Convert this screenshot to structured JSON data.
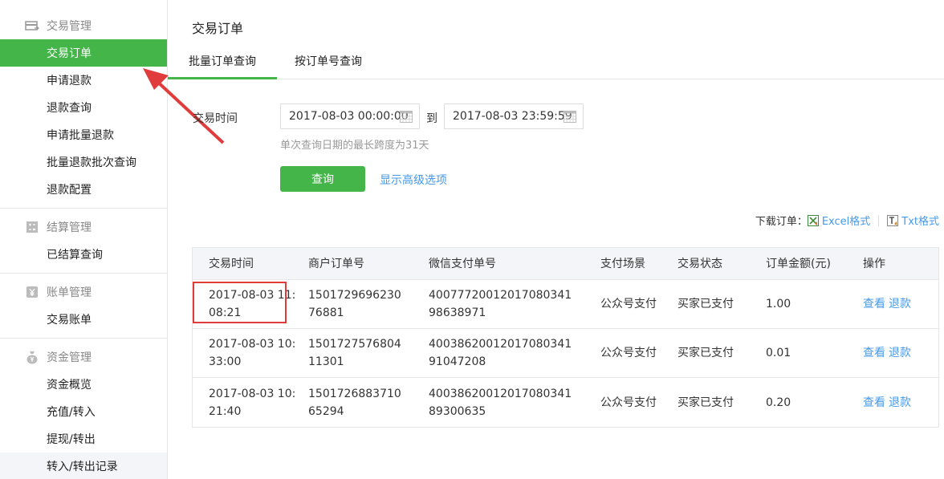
{
  "sidebar": {
    "sections": [
      {
        "title": "交易管理",
        "icon": "transaction-icon",
        "items": [
          "交易订单",
          "申请退款",
          "退款查询",
          "申请批量退款",
          "批量退款批次查询",
          "退款配置"
        ]
      },
      {
        "title": "结算管理",
        "icon": "calculator-icon",
        "items": [
          "已结算查询"
        ]
      },
      {
        "title": "账单管理",
        "icon": "yuan-icon",
        "items": [
          "交易账单"
        ]
      },
      {
        "title": "资金管理",
        "icon": "money-bag-icon",
        "items": [
          "资金概览",
          "充值/转入",
          "提现/转出",
          "转入/转出记录"
        ]
      }
    ]
  },
  "page": {
    "title": "交易订单"
  },
  "tabs": [
    "批量订单查询",
    "按订单号查询"
  ],
  "filter": {
    "time_label": "交易时间",
    "start": "2017-08-03 00:00:00",
    "to": "到",
    "end": "2017-08-03 23:59:59",
    "hint": "单次查询日期的最长跨度为31天",
    "query_btn": "查询",
    "advanced_link": "显示高级选项"
  },
  "download": {
    "label": "下载订单：",
    "excel": "Excel格式",
    "txt": "Txt格式"
  },
  "table": {
    "headers": [
      "交易时间",
      "商户订单号",
      "微信支付单号",
      "支付场景",
      "交易状态",
      "订单金额(元)",
      "操作"
    ],
    "rows": [
      {
        "time": "2017-08-03 11:08:21",
        "merchant_no": "150172969623076881",
        "wx_no": "4007772001201708034198638971",
        "scene": "公众号支付",
        "status": "买家已支付",
        "amount": "1.00",
        "view": "查看",
        "refund": "退款"
      },
      {
        "time": "2017-08-03 10:33:00",
        "merchant_no": "150172757680411301",
        "wx_no": "4003862001201708034191047208",
        "scene": "公众号支付",
        "status": "买家已支付",
        "amount": "0.01",
        "view": "查看",
        "refund": "退款"
      },
      {
        "time": "2017-08-03 10:21:40",
        "merchant_no": "150172688371065294",
        "wx_no": "4003862001201708034189300635",
        "scene": "公众号支付",
        "status": "买家已支付",
        "amount": "0.20",
        "view": "查看",
        "refund": "退款"
      }
    ]
  },
  "colors": {
    "accent": "#44b549",
    "link": "#459ae9",
    "annotation": "#e03c3c"
  }
}
